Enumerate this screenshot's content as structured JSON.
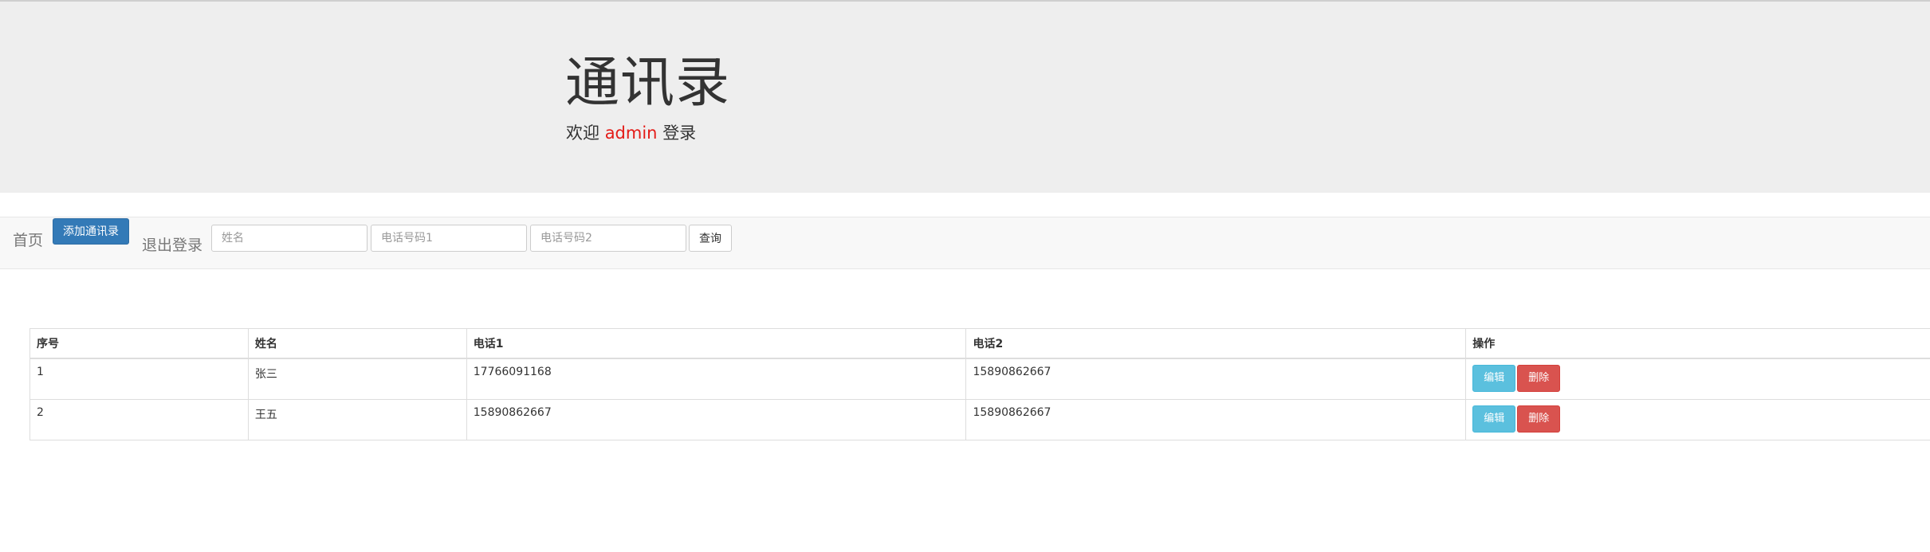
{
  "header": {
    "title": "通讯录",
    "welcome_prefix": "欢迎",
    "username": "admin",
    "welcome_suffix": "登录"
  },
  "nav": {
    "home_label": "首页",
    "add_label": "添加通讯录",
    "logout_label": "退出登录",
    "search": {
      "name_placeholder": "姓名",
      "phone1_placeholder": "电话号码1",
      "phone2_placeholder": "电话号码2",
      "query_label": "查询"
    }
  },
  "table": {
    "columns": [
      "序号",
      "姓名",
      "电话1",
      "电话2",
      "操作"
    ],
    "rows": [
      {
        "id": "1",
        "name": "张三",
        "phone1": "17766091168",
        "phone2": "15890862667"
      },
      {
        "id": "2",
        "name": "王五",
        "phone1": "15890862667",
        "phone2": "15890862667"
      }
    ],
    "edit_label": "编辑",
    "delete_label": "删除"
  },
  "colors": {
    "primary": "#337ab7",
    "info": "#5bc0de",
    "danger": "#d9534f",
    "username": "#e41b17",
    "jumbotron_bg": "#eeeeee"
  }
}
